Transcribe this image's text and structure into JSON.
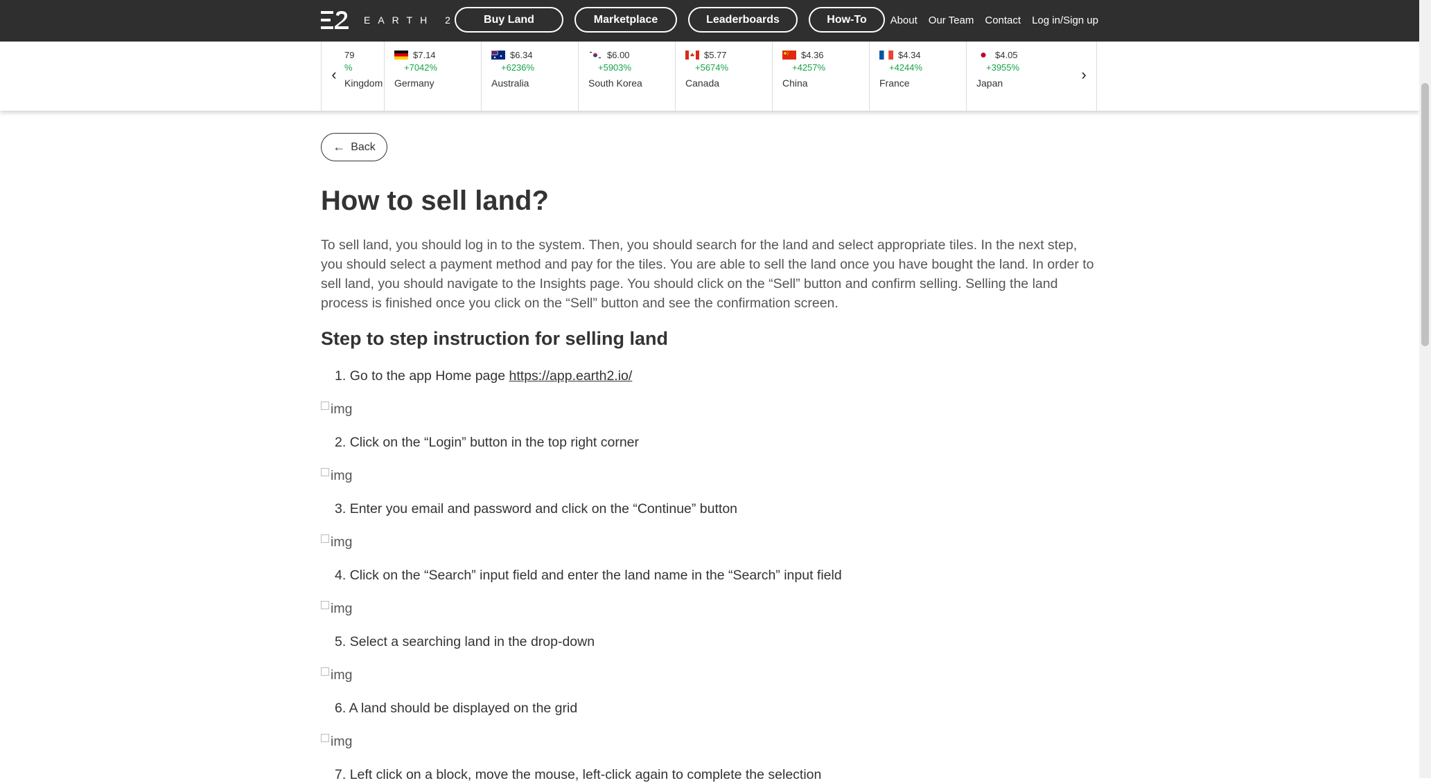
{
  "nav": {
    "logo_text": "EARTH 2",
    "pills": [
      "Buy Land",
      "Marketplace",
      "Leaderboards",
      "How-To"
    ],
    "links": [
      "About",
      "Our Team",
      "Contact",
      "Log in/Sign up"
    ]
  },
  "ticker": {
    "partial": {
      "price": "79",
      "change": "%",
      "country": "Kingdom"
    },
    "items": [
      {
        "price": "$7.14",
        "change": "+7042%",
        "country": "Germany",
        "flag": "de"
      },
      {
        "price": "$6.34",
        "change": "+6236%",
        "country": "Australia",
        "flag": "au"
      },
      {
        "price": "$6.00",
        "change": "+5903%",
        "country": "South Korea",
        "flag": "kr"
      },
      {
        "price": "$5.77",
        "change": "+5674%",
        "country": "Canada",
        "flag": "ca"
      },
      {
        "price": "$4.36",
        "change": "+4257%",
        "country": "China",
        "flag": "cn"
      },
      {
        "price": "$4.34",
        "change": "+4244%",
        "country": "France",
        "flag": "fr"
      },
      {
        "price": "$4.05",
        "change": "+3955%",
        "country": "Japan",
        "flag": "jp"
      }
    ],
    "prev_icon": "chevron-left-icon",
    "next_icon": "chevron-right-icon"
  },
  "content": {
    "back_label": "Back",
    "title": "How to sell land?",
    "intro": "To sell land, you should log in to the system. Then, you should search for the land and select appropriate tiles. In the next step, you should select a payment method and pay for the tiles. You are able to sell the land once you have bought the land. In order to sell land, you should navigate to the Insights page. You should click on the “Sell” button and confirm selling. Selling the land process is finished once you click on the “Sell” button and see the confirmation screen.",
    "subtitle": "Step to step instruction for selling land",
    "img_alt": "img",
    "steps": [
      {
        "num": "1.",
        "text": "Go to the app Home page ",
        "link": "https://app.earth2.io/"
      },
      {
        "num": "2.",
        "text": "Click on the “Login” button in the top right corner"
      },
      {
        "num": "3.",
        "text": "Enter you email and password and click on the “Continue” button"
      },
      {
        "num": "4.",
        "text": "Click on the “Search” input field and enter the land name in the “Search” input field"
      },
      {
        "num": "5.",
        "text": "Select a searching land in the drop-down"
      },
      {
        "num": "6.",
        "text": "A land should be displayed on the grid"
      },
      {
        "num": "7.",
        "text": "Left click on a block, move the mouse, left-click again to complete the selection"
      }
    ]
  }
}
